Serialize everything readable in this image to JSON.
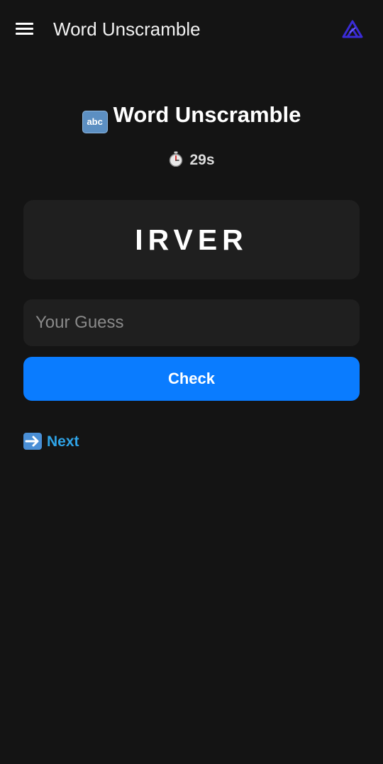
{
  "appbar": {
    "title": "Word Unscramble",
    "menu_icon": "hamburger-menu-icon",
    "logo_icon": "brand-logo-icon",
    "logo_color": "#3a2bd6"
  },
  "game": {
    "title_emoji": "abc",
    "title": "Word Unscramble",
    "timer_icon": "stopwatch-icon",
    "timer": "29s",
    "scrambled_word": "IRVER"
  },
  "form": {
    "guess_placeholder": "Your Guess",
    "guess_value": "",
    "check_label": "Check"
  },
  "next": {
    "icon": "right-arrow-icon",
    "label": "Next"
  },
  "colors": {
    "background": "#141414",
    "card": "#1f1f1f",
    "primary_button": "#0a7cff",
    "link": "#2fa3e6"
  }
}
